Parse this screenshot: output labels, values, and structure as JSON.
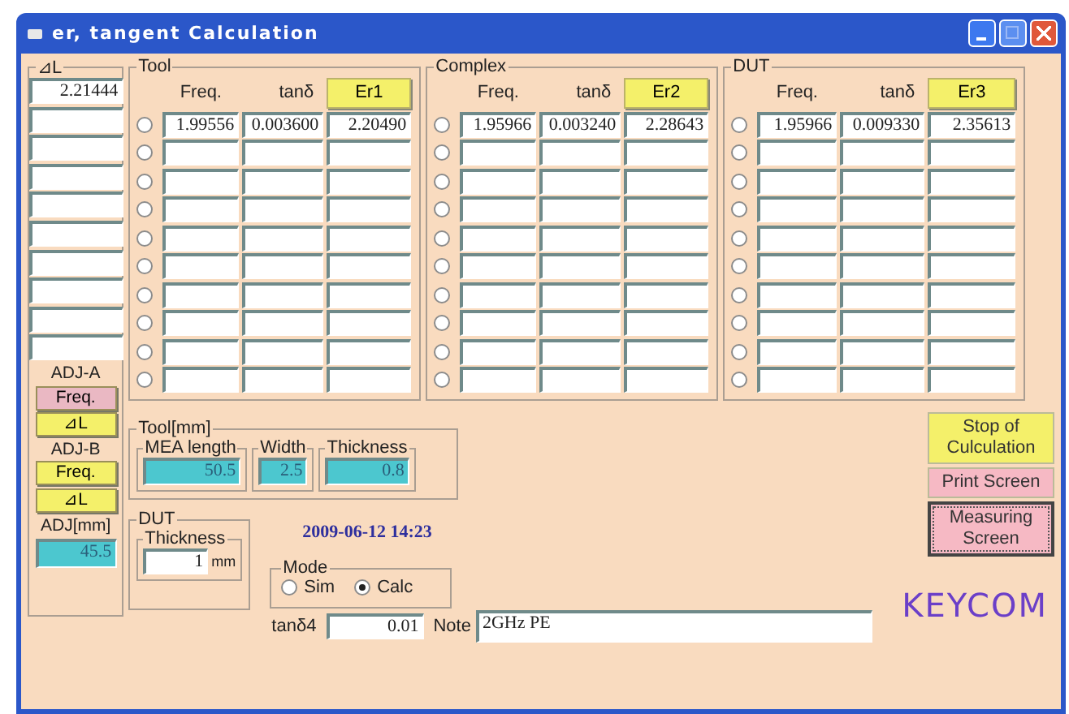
{
  "window": {
    "title": "er, tangent Calculation"
  },
  "delta_l": {
    "label": "⊿L",
    "cells": [
      {
        "value": "2.21444"
      },
      {},
      {},
      {},
      {},
      {},
      {},
      {},
      {},
      {}
    ]
  },
  "adjust": [
    {
      "label": "ADJ-A",
      "buttons": [
        {
          "label": "Freq.",
          "selected": true
        },
        {
          "label": "⊿L",
          "selected": false
        }
      ]
    },
    {
      "label": "ADJ-B",
      "buttons": [
        {
          "label": "Freq.",
          "selected": false
        },
        {
          "label": "⊿L",
          "selected": false
        }
      ]
    }
  ],
  "adj_mm": {
    "label": "ADJ[mm]",
    "value": "45.5"
  },
  "tables": [
    {
      "title": "Tool",
      "columns": [
        "Freq.",
        "tanδ"
      ],
      "er_button": "Er1",
      "rows": [
        {
          "selected": false,
          "freq": "1.99556",
          "tan": "0.003600",
          "er": "2.20490"
        },
        {
          "selected": false
        },
        {
          "selected": false
        },
        {
          "selected": false
        },
        {
          "selected": false
        },
        {
          "selected": false
        },
        {
          "selected": false
        },
        {
          "selected": false
        },
        {
          "selected": false
        },
        {
          "selected": false
        }
      ]
    },
    {
      "title": "Complex",
      "columns": [
        "Freq.",
        "tanδ"
      ],
      "er_button": "Er2",
      "rows": [
        {
          "selected": false,
          "freq": "1.95966",
          "tan": "0.003240",
          "er": "2.28643"
        },
        {
          "selected": false
        },
        {
          "selected": false
        },
        {
          "selected": false
        },
        {
          "selected": false
        },
        {
          "selected": false
        },
        {
          "selected": false
        },
        {
          "selected": false
        },
        {
          "selected": false
        },
        {
          "selected": false
        }
      ]
    },
    {
      "title": "DUT",
      "columns": [
        "Freq.",
        "tanδ"
      ],
      "er_button": "Er3",
      "rows": [
        {
          "selected": false,
          "freq": "1.95966",
          "tan": "0.009330",
          "er": "2.35613"
        },
        {
          "selected": false
        },
        {
          "selected": false
        },
        {
          "selected": false
        },
        {
          "selected": false
        },
        {
          "selected": false
        },
        {
          "selected": false
        },
        {
          "selected": false
        },
        {
          "selected": false
        },
        {
          "selected": false
        }
      ]
    }
  ],
  "tool_mm": {
    "title": "Tool[mm]",
    "fields": [
      {
        "label": "MEA length",
        "value": "50.5"
      },
      {
        "label": "Width",
        "value": "2.5"
      },
      {
        "label": "Thickness",
        "value": "0.8"
      }
    ]
  },
  "dut": {
    "title": "DUT",
    "field": {
      "label": "Thickness",
      "value": "1",
      "unit": "mm"
    }
  },
  "timestamp": "2009-06-12 14:23",
  "mode": {
    "title": "Mode",
    "options": [
      {
        "label": "Sim",
        "selected": false
      },
      {
        "label": "Calc",
        "selected": true
      }
    ]
  },
  "tan4": {
    "label": "tanδ4",
    "value": "0.01"
  },
  "note": {
    "label": "Note",
    "value": "2GHz PE"
  },
  "actions": [
    {
      "label": "Stop of Culculation",
      "color": "#f4f06a",
      "focused": false
    },
    {
      "label": "Print Screen",
      "color": "#f6b9c4",
      "focused": false
    },
    {
      "label": "Measuring Screen",
      "color": "#f6b9c4",
      "focused": true
    }
  ],
  "logo": "KEYCOM"
}
